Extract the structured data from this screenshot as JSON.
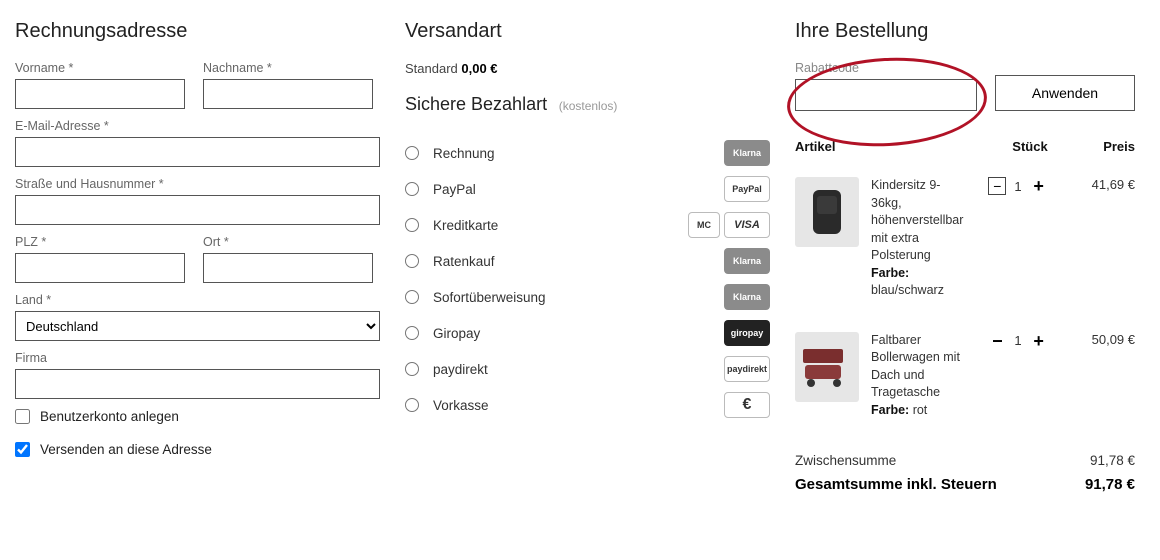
{
  "billing": {
    "heading": "Rechnungsadresse",
    "firstname_label": "Vorname *",
    "lastname_label": "Nachname *",
    "email_label": "E-Mail-Adresse *",
    "street_label": "Straße und Hausnummer *",
    "zip_label": "PLZ *",
    "city_label": "Ort *",
    "country_label": "Land *",
    "country_value": "Deutschland",
    "company_label": "Firma",
    "create_account_label": "Benutzerkonto anlegen",
    "ship_same_label": "Versenden an diese Adresse"
  },
  "shipping": {
    "heading": "Versandart",
    "method": "Standard",
    "cost": "0,00 €"
  },
  "payment": {
    "heading": "Sichere Bezahlart",
    "note": "(kostenlos)",
    "methods": [
      {
        "label": "Rechnung",
        "logo": "Klarna"
      },
      {
        "label": "PayPal",
        "logo": "PayPal"
      },
      {
        "label": "Kreditkarte",
        "logo": "MC+VISA"
      },
      {
        "label": "Ratenkauf",
        "logo": "Klarna"
      },
      {
        "label": "Sofortüberweisung",
        "logo": "Klarna"
      },
      {
        "label": "Giropay",
        "logo": "giropay"
      },
      {
        "label": "paydirekt",
        "logo": "paydirekt"
      },
      {
        "label": "Vorkasse",
        "logo": "€"
      }
    ]
  },
  "order": {
    "heading": "Ihre Bestellung",
    "promo_label": "Rabattcode",
    "apply_label": "Anwenden",
    "col_article": "Artikel",
    "col_qty": "Stück",
    "col_price": "Preis",
    "items": [
      {
        "name": "Kindersitz 9-36kg, höhenverstellbar mit extra Polsterung",
        "variant_label": "Farbe:",
        "variant_value": "blau/schwarz",
        "qty": "1",
        "price": "41,69 €"
      },
      {
        "name": "Faltbarer Bollerwagen mit Dach und Tragetasche",
        "variant_label": "Farbe:",
        "variant_value": "rot",
        "qty": "1",
        "price": "50,09 €"
      }
    ],
    "subtotal_label": "Zwischensumme",
    "subtotal_value": "91,78 €",
    "grandtotal_label": "Gesamtsumme inkl. Steuern",
    "grandtotal_value": "91,78 €"
  }
}
